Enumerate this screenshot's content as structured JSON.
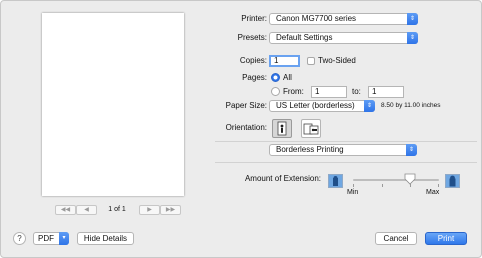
{
  "preview": {
    "page_indicator": "1 of 1",
    "first_page": "◀◀",
    "prev_page": "◀",
    "next_page": "▶",
    "last_page": "▶▶"
  },
  "printer": {
    "label": "Printer:",
    "value": "Canon MG7700 series"
  },
  "presets": {
    "label": "Presets:",
    "value": "Default Settings"
  },
  "copies": {
    "label": "Copies:",
    "value": "1",
    "two_sided_label": "Two-Sided",
    "two_sided_checked": false
  },
  "pages": {
    "label": "Pages:",
    "all_label": "All",
    "from_label": "From:",
    "from_value": "1",
    "to_label": "to:",
    "to_value": "1",
    "selected": "All"
  },
  "paper_size": {
    "label": "Paper Size:",
    "value": "US Letter (borderless)",
    "dimensions": "8.50 by 11.00 inches"
  },
  "orientation": {
    "label": "Orientation:",
    "selected": "portrait"
  },
  "section_popup": {
    "value": "Borderless Printing"
  },
  "extension": {
    "label": "Amount of Extension:",
    "min_label": "Min",
    "max_label": "Max",
    "level_fraction": 0.66
  },
  "footer": {
    "help": "?",
    "pdf_label": "PDF",
    "hide_details": "Hide Details",
    "cancel": "Cancel",
    "print": "Print"
  },
  "colors": {
    "accent": "#2f74e8",
    "background": "#ececec"
  }
}
